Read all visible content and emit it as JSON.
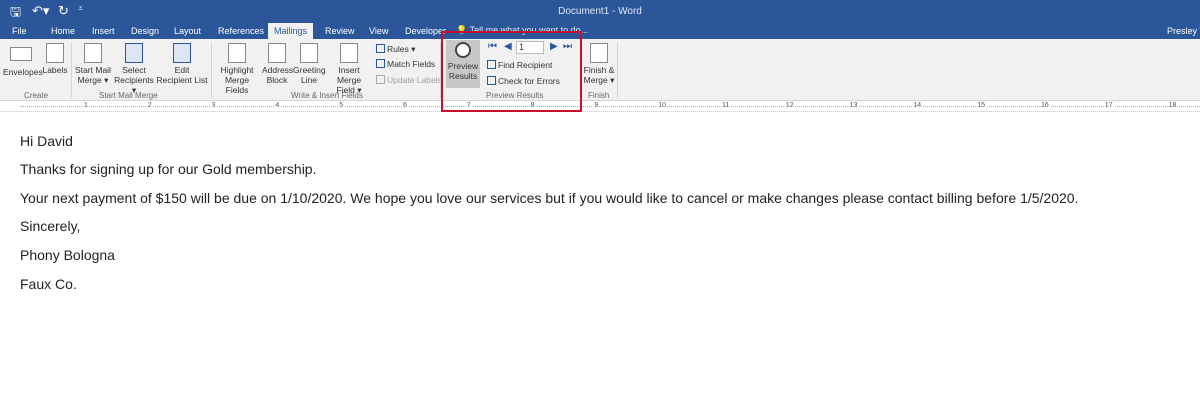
{
  "window": {
    "title": "Document1 - Word",
    "user": "Presley Tr"
  },
  "quick_access": {
    "save_icon": "save-icon",
    "undo_icon": "undo-icon",
    "redo_icon": "redo-icon",
    "customize_icon": "customize-icon"
  },
  "tabs": [
    "File",
    "Home",
    "Insert",
    "Design",
    "Layout",
    "References",
    "Mailings",
    "Review",
    "View",
    "Developer"
  ],
  "active_tab": "Mailings",
  "tell_me": "Tell me what you want to do...",
  "ribbon": {
    "create": {
      "label": "Create",
      "envelopes": "Envelopes",
      "labels": "Labels"
    },
    "start": {
      "label": "Start Mail Merge",
      "start_mail_merge": [
        "Start Mail",
        "Merge ▾"
      ],
      "select_recipients": [
        "Select",
        "Recipients ▾"
      ],
      "edit_list": [
        "Edit",
        "Recipient List"
      ]
    },
    "write": {
      "label": "Write & Insert Fields",
      "highlight": [
        "Highlight",
        "Merge Fields"
      ],
      "address": [
        "Address",
        "Block"
      ],
      "greeting": [
        "Greeting",
        "Line"
      ],
      "insert": [
        "Insert Merge",
        "Field ▾"
      ],
      "rules": "Rules ▾",
      "match": "Match Fields",
      "update": "Update Labels"
    },
    "preview": {
      "label": "Preview Results",
      "preview": [
        "Preview",
        "Results"
      ],
      "record": "1",
      "find": "Find Recipient",
      "check": "Check for Errors",
      "first": "⏮",
      "prev": "◀",
      "next": "▶",
      "last": "⏭"
    },
    "finish": {
      "label": "Finish",
      "finish_merge": [
        "Finish &",
        "Merge ▾"
      ]
    }
  },
  "ruler": [
    "1",
    "2",
    "3",
    "4",
    "5",
    "6",
    "7",
    "8",
    "9",
    "10",
    "11",
    "12",
    "13",
    "14",
    "15",
    "16",
    "17",
    "18"
  ],
  "document": {
    "lines": [
      "Hi David",
      "Thanks for signing up for our Gold membership.",
      "Your next payment of $150 will be due on 1/10/2020. We hope you love our services but if you would like to cancel or make changes please contact billing before 1/5/2020.",
      "Sincerely,",
      "Phony Bologna",
      "Faux Co."
    ]
  },
  "colors": {
    "brand": "#2b579a",
    "highlight_box": "#c8102e"
  }
}
